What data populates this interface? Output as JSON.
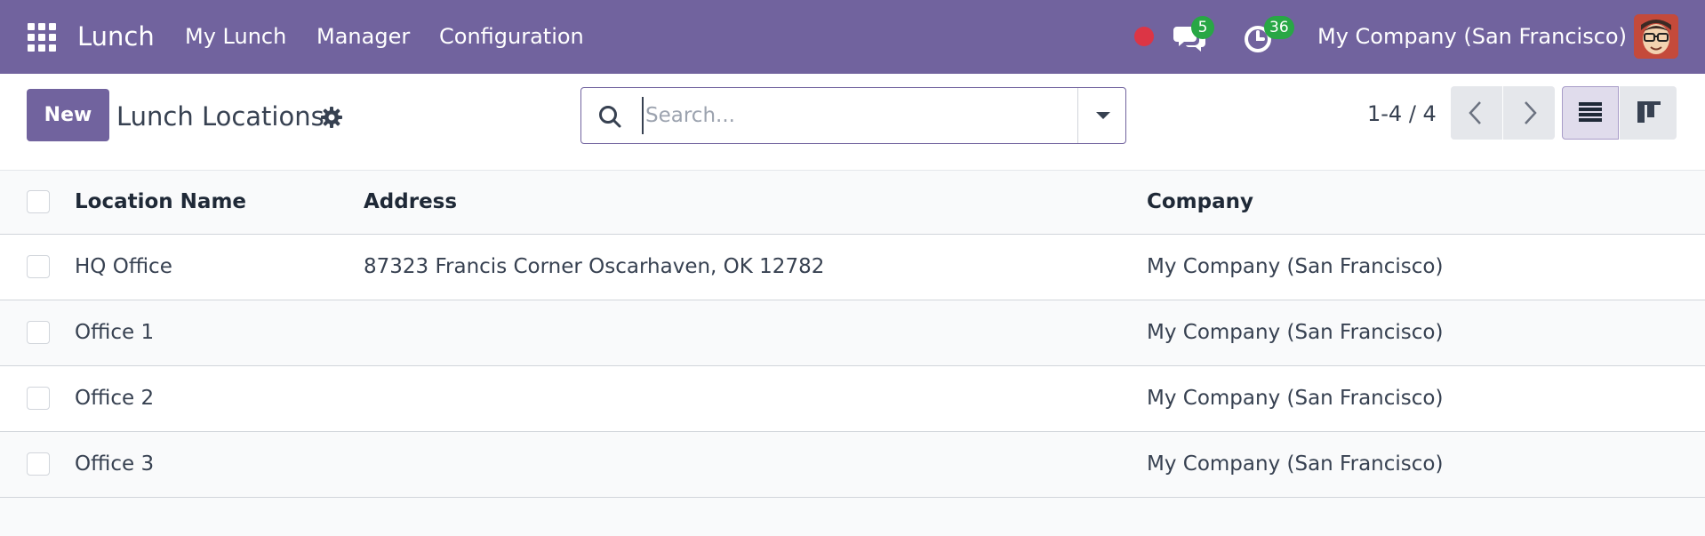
{
  "colors": {
    "brand": "#71639e",
    "badge": "#28a745",
    "recording": "#dc3545"
  },
  "navbar": {
    "apps_icon": "grid-apps-icon",
    "app_name": "Lunch",
    "menu": [
      {
        "label": "My Lunch"
      },
      {
        "label": "Manager"
      },
      {
        "label": "Configuration"
      }
    ],
    "recording_icon": "record-dot-icon",
    "messages": {
      "icon": "chat-bubbles-icon",
      "count": "5"
    },
    "activities": {
      "icon": "clock-icon",
      "count": "36"
    },
    "company": "My Company (San Francisco)",
    "avatar_icon": "user-avatar"
  },
  "control_panel": {
    "new_label": "New",
    "title": "Lunch Locations",
    "settings_icon": "gear-icon",
    "search": {
      "icon": "search-icon",
      "placeholder": "Search...",
      "value": "",
      "toggle_icon": "caret-down-icon"
    },
    "pager": {
      "value": "1-4 / 4",
      "prev_icon": "chevron-left-icon",
      "next_icon": "chevron-right-icon"
    },
    "views": [
      {
        "name": "list",
        "icon": "list-view-icon",
        "active": true
      },
      {
        "name": "kanban",
        "icon": "kanban-view-icon",
        "active": false
      }
    ]
  },
  "table": {
    "columns": [
      "Location Name",
      "Address",
      "Company"
    ],
    "rows": [
      {
        "name": "HQ Office",
        "address": "87323 Francis Corner Oscarhaven, OK 12782",
        "company": "My Company (San Francisco)"
      },
      {
        "name": "Office 1",
        "address": "",
        "company": "My Company (San Francisco)"
      },
      {
        "name": "Office 2",
        "address": "",
        "company": "My Company (San Francisco)"
      },
      {
        "name": "Office 3",
        "address": "",
        "company": "My Company (San Francisco)"
      }
    ]
  }
}
